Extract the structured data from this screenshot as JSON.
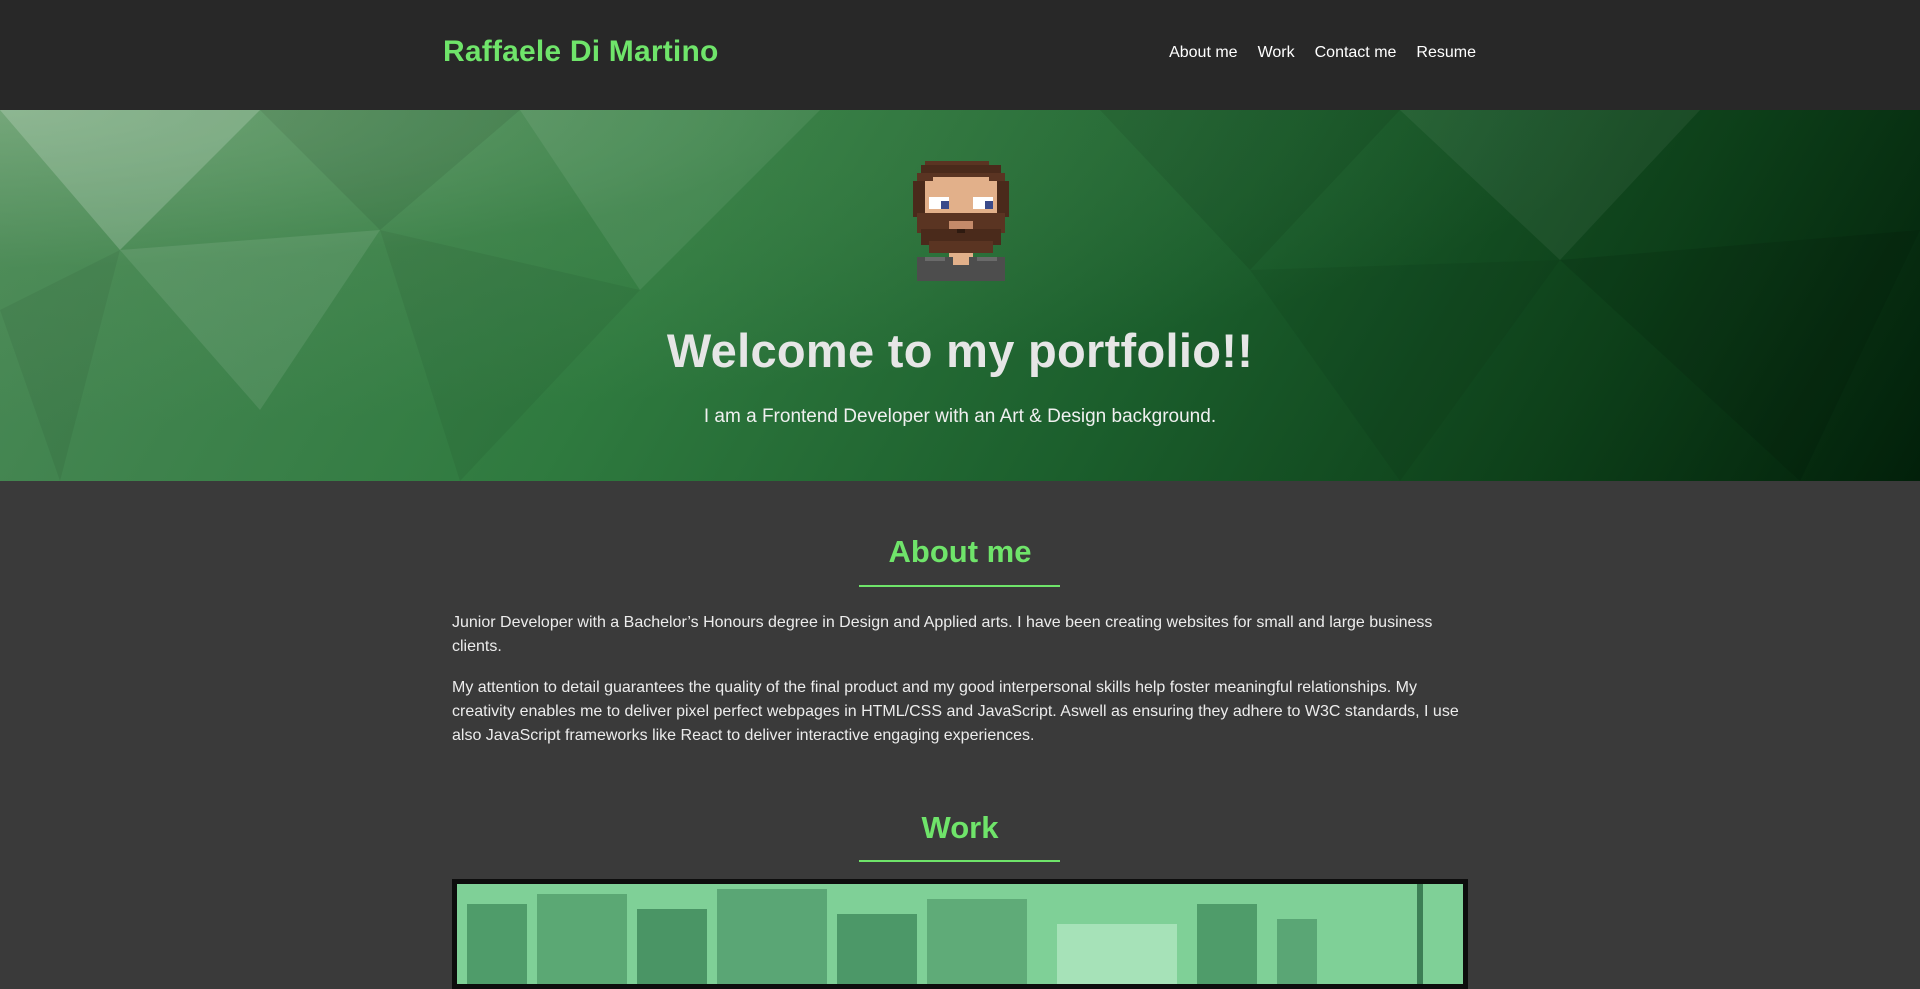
{
  "header": {
    "brand": "Raffaele Di Martino",
    "nav": [
      "About me",
      "Work",
      "Contact me",
      "Resume"
    ]
  },
  "hero": {
    "title": "Welcome to my portfolio!!",
    "subtitle": "I am a Frontend Developer with an Art & Design background."
  },
  "about": {
    "title": "About me",
    "paragraphs": [
      "Junior Developer with a Bachelor’s Honours degree in Design and Applied arts. I have been creating websites for small and large business clients.",
      "My attention to detail guarantees the quality of the final product and my good interpersonal skills help foster meaningful relationships. My creativity enables me to deliver pixel perfect webpages in HTML/CSS and JavaScript. Aswell as ensuring they adhere to W3C standards, I use also JavaScript frameworks like React to deliver interactive engaging experiences."
    ]
  },
  "work": {
    "title": "Work"
  },
  "colors": {
    "accent": "#6fe46a",
    "header_bg": "#282828",
    "page_bg": "#3a3a3a"
  }
}
